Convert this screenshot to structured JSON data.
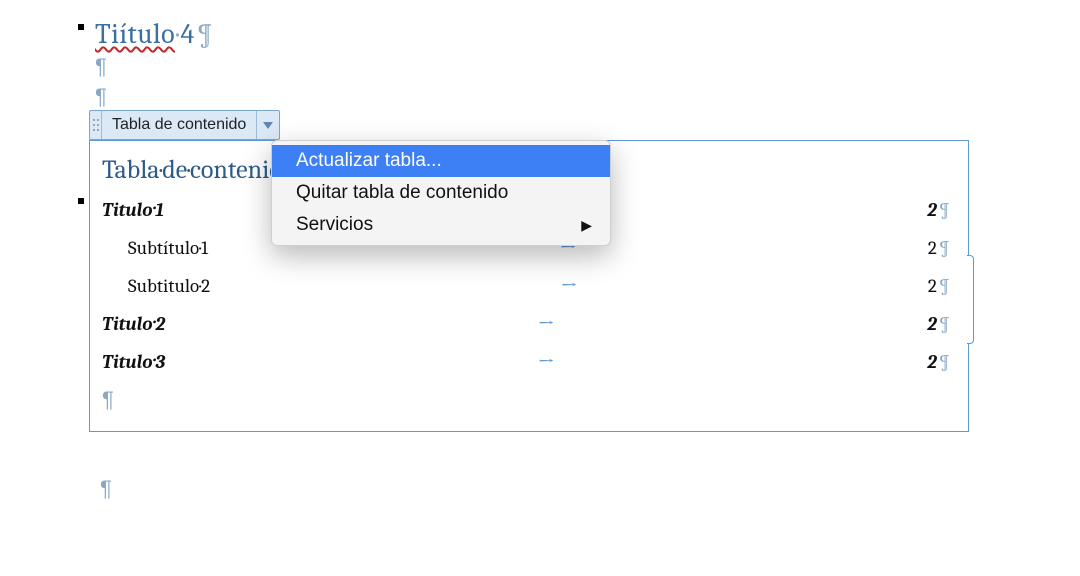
{
  "heading": {
    "text_wavy": "Tiítulo",
    "text_rest": "4"
  },
  "pilcrow": "¶",
  "middot": "·",
  "toc_tab": {
    "label": "Tabla de contenido"
  },
  "menu": {
    "items": [
      {
        "label": "Actualizar tabla...",
        "highlight": true,
        "submenu": false
      },
      {
        "label": "Quitar tabla de contenido",
        "highlight": false,
        "submenu": false
      },
      {
        "label": "Servicios",
        "highlight": false,
        "submenu": true
      }
    ],
    "submenu_glyph": "▶"
  },
  "toc": {
    "title": "Tabla de contenido",
    "tab_arrow": "→",
    "rows": [
      {
        "label": "Titulo 1",
        "level": 1,
        "page": "2"
      },
      {
        "label": "Subtítulo 1",
        "level": 2,
        "page": "2"
      },
      {
        "label": "Subtitulo 2",
        "level": 2,
        "page": "2"
      },
      {
        "label": "Titulo 2",
        "level": 1,
        "page": "2"
      },
      {
        "label": "Titulo 3",
        "level": 1,
        "page": "2"
      }
    ]
  }
}
